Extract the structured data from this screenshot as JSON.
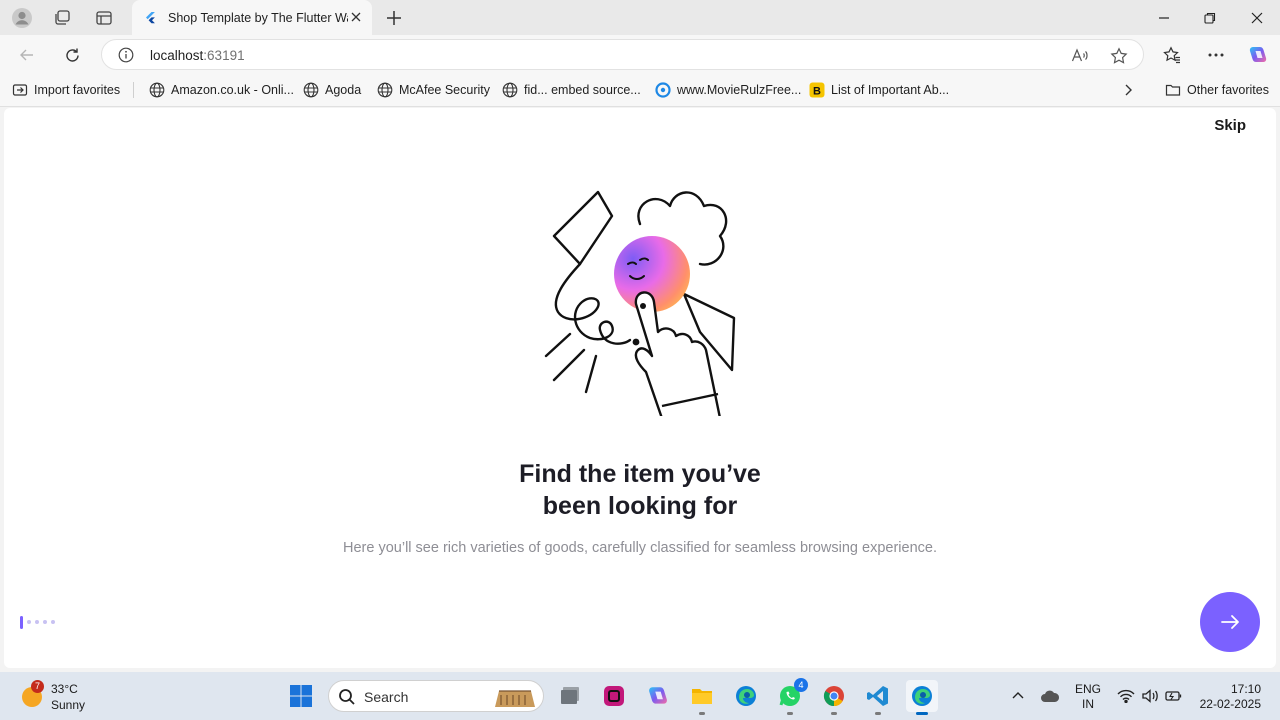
{
  "browser": {
    "tab_title": "Shop Template by The Flutter Way",
    "url_host": "localhost",
    "url_port": ":63191"
  },
  "favorites": [
    {
      "label": "Import favorites",
      "icon": "import-icon"
    },
    {
      "label": "Amazon.co.uk - Onli...",
      "icon": "globe-icon"
    },
    {
      "label": "Agoda",
      "icon": "globe-icon"
    },
    {
      "label": "McAfee Security",
      "icon": "globe-icon"
    },
    {
      "label": "fid... embed source...",
      "icon": "globe-icon"
    },
    {
      "label": "www.MovieRulzFree...",
      "icon": "site-icon"
    },
    {
      "label": "List of Important Ab...",
      "icon": "b-site-icon"
    }
  ],
  "other_favorites": "Other favorites",
  "onboarding": {
    "skip": "Skip",
    "title_line1": "Find the item you’ve",
    "title_line2": "been looking for",
    "description": "Here you’ll see rich varieties of goods, carefully classified for seamless browsing experience.",
    "page_count": 5,
    "active_page": 1,
    "accent": "#7b61ff"
  },
  "taskbar": {
    "weather_badge": "7",
    "temperature": "33°C",
    "condition": "Sunny",
    "search_label": "Search",
    "whatsapp_badge": "4",
    "lang_line1": "ENG",
    "lang_line2": "IN",
    "time": "17:10",
    "date": "22-02-2025"
  }
}
